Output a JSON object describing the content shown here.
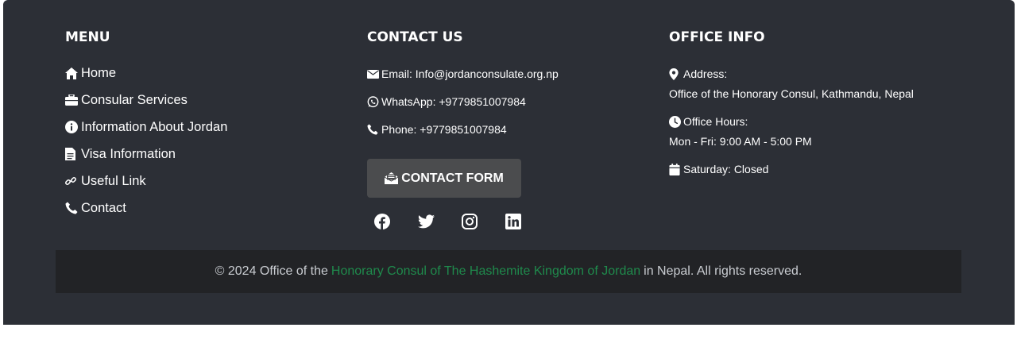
{
  "menu": {
    "heading": "MENU",
    "items": [
      {
        "label": "Home",
        "icon": "home-icon"
      },
      {
        "label": "Consular Services",
        "icon": "briefcase-icon"
      },
      {
        "label": "Information About Jordan",
        "icon": "info-icon"
      },
      {
        "label": "Visa Information",
        "icon": "document-icon"
      },
      {
        "label": "Useful Link",
        "icon": "link-icon"
      },
      {
        "label": "Contact",
        "icon": "phone-icon"
      }
    ]
  },
  "contact": {
    "heading": "CONTACT US",
    "email": "Email: Info@jordanconsulate.org.np",
    "whatsapp": "WhatsApp: +9779851007984",
    "phone": "Phone: +9779851007984",
    "button_label": "CONTACT FORM",
    "social": [
      "facebook-icon",
      "twitter-icon",
      "instagram-icon",
      "linkedin-icon"
    ]
  },
  "office": {
    "heading": "OFFICE INFO",
    "address_label": "Address:",
    "address_value": "Office of the Honorary Consul, Kathmandu, Nepal",
    "hours_label": "Office Hours:",
    "hours_value": "Mon - Fri: 9:00 AM - 5:00 PM",
    "saturday": "Saturday: Closed"
  },
  "copyright": {
    "prefix": "© 2024 Office of the",
    "link": "Honorary Consul of The Hashemite Kingdom of Jordan",
    "suffix": "in Nepal. All rights reserved."
  },
  "colors": {
    "footer_bg": "#2c2f36",
    "copyright_bg": "#222326",
    "link_green": "#1f8a4c",
    "button_bg": "#4b4c4e"
  }
}
